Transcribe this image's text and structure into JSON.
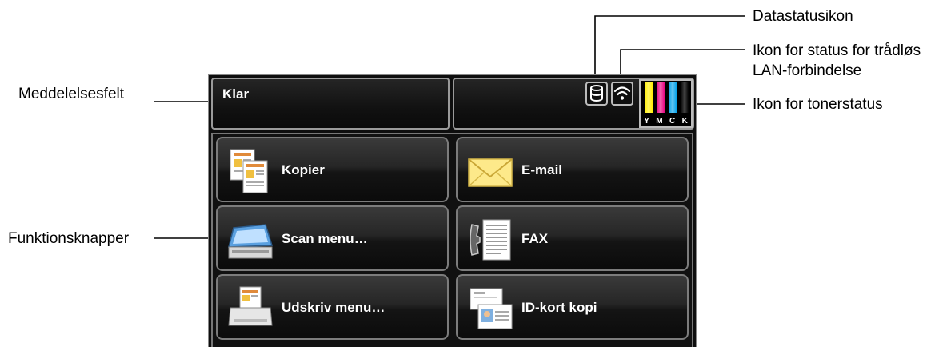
{
  "callouts": {
    "message_field": "Meddelelsesfelt",
    "function_buttons": "Funktionsknapper",
    "data_status_icon": "Datastatusikon",
    "wireless_status_icon_line1": "Ikon for status for trådløs",
    "wireless_status_icon_line2": "LAN-forbindelse",
    "toner_status_icon": "Ikon for tonerstatus"
  },
  "panel": {
    "message": "Klar",
    "toner_labels": [
      "Y",
      "M",
      "C",
      "K"
    ],
    "toner_colors": [
      "#ffee00",
      "#e6007e",
      "#00a0e9",
      "#111111"
    ]
  },
  "buttons": [
    {
      "label": "Kopier",
      "icon": "copy-icon"
    },
    {
      "label": "E-mail",
      "icon": "envelope-icon"
    },
    {
      "label": "Scan menu…",
      "icon": "scanner-icon"
    },
    {
      "label": "FAX",
      "icon": "fax-icon"
    },
    {
      "label": "Udskriv menu…",
      "icon": "printer-icon"
    },
    {
      "label": "ID-kort kopi",
      "icon": "id-card-icon"
    }
  ]
}
